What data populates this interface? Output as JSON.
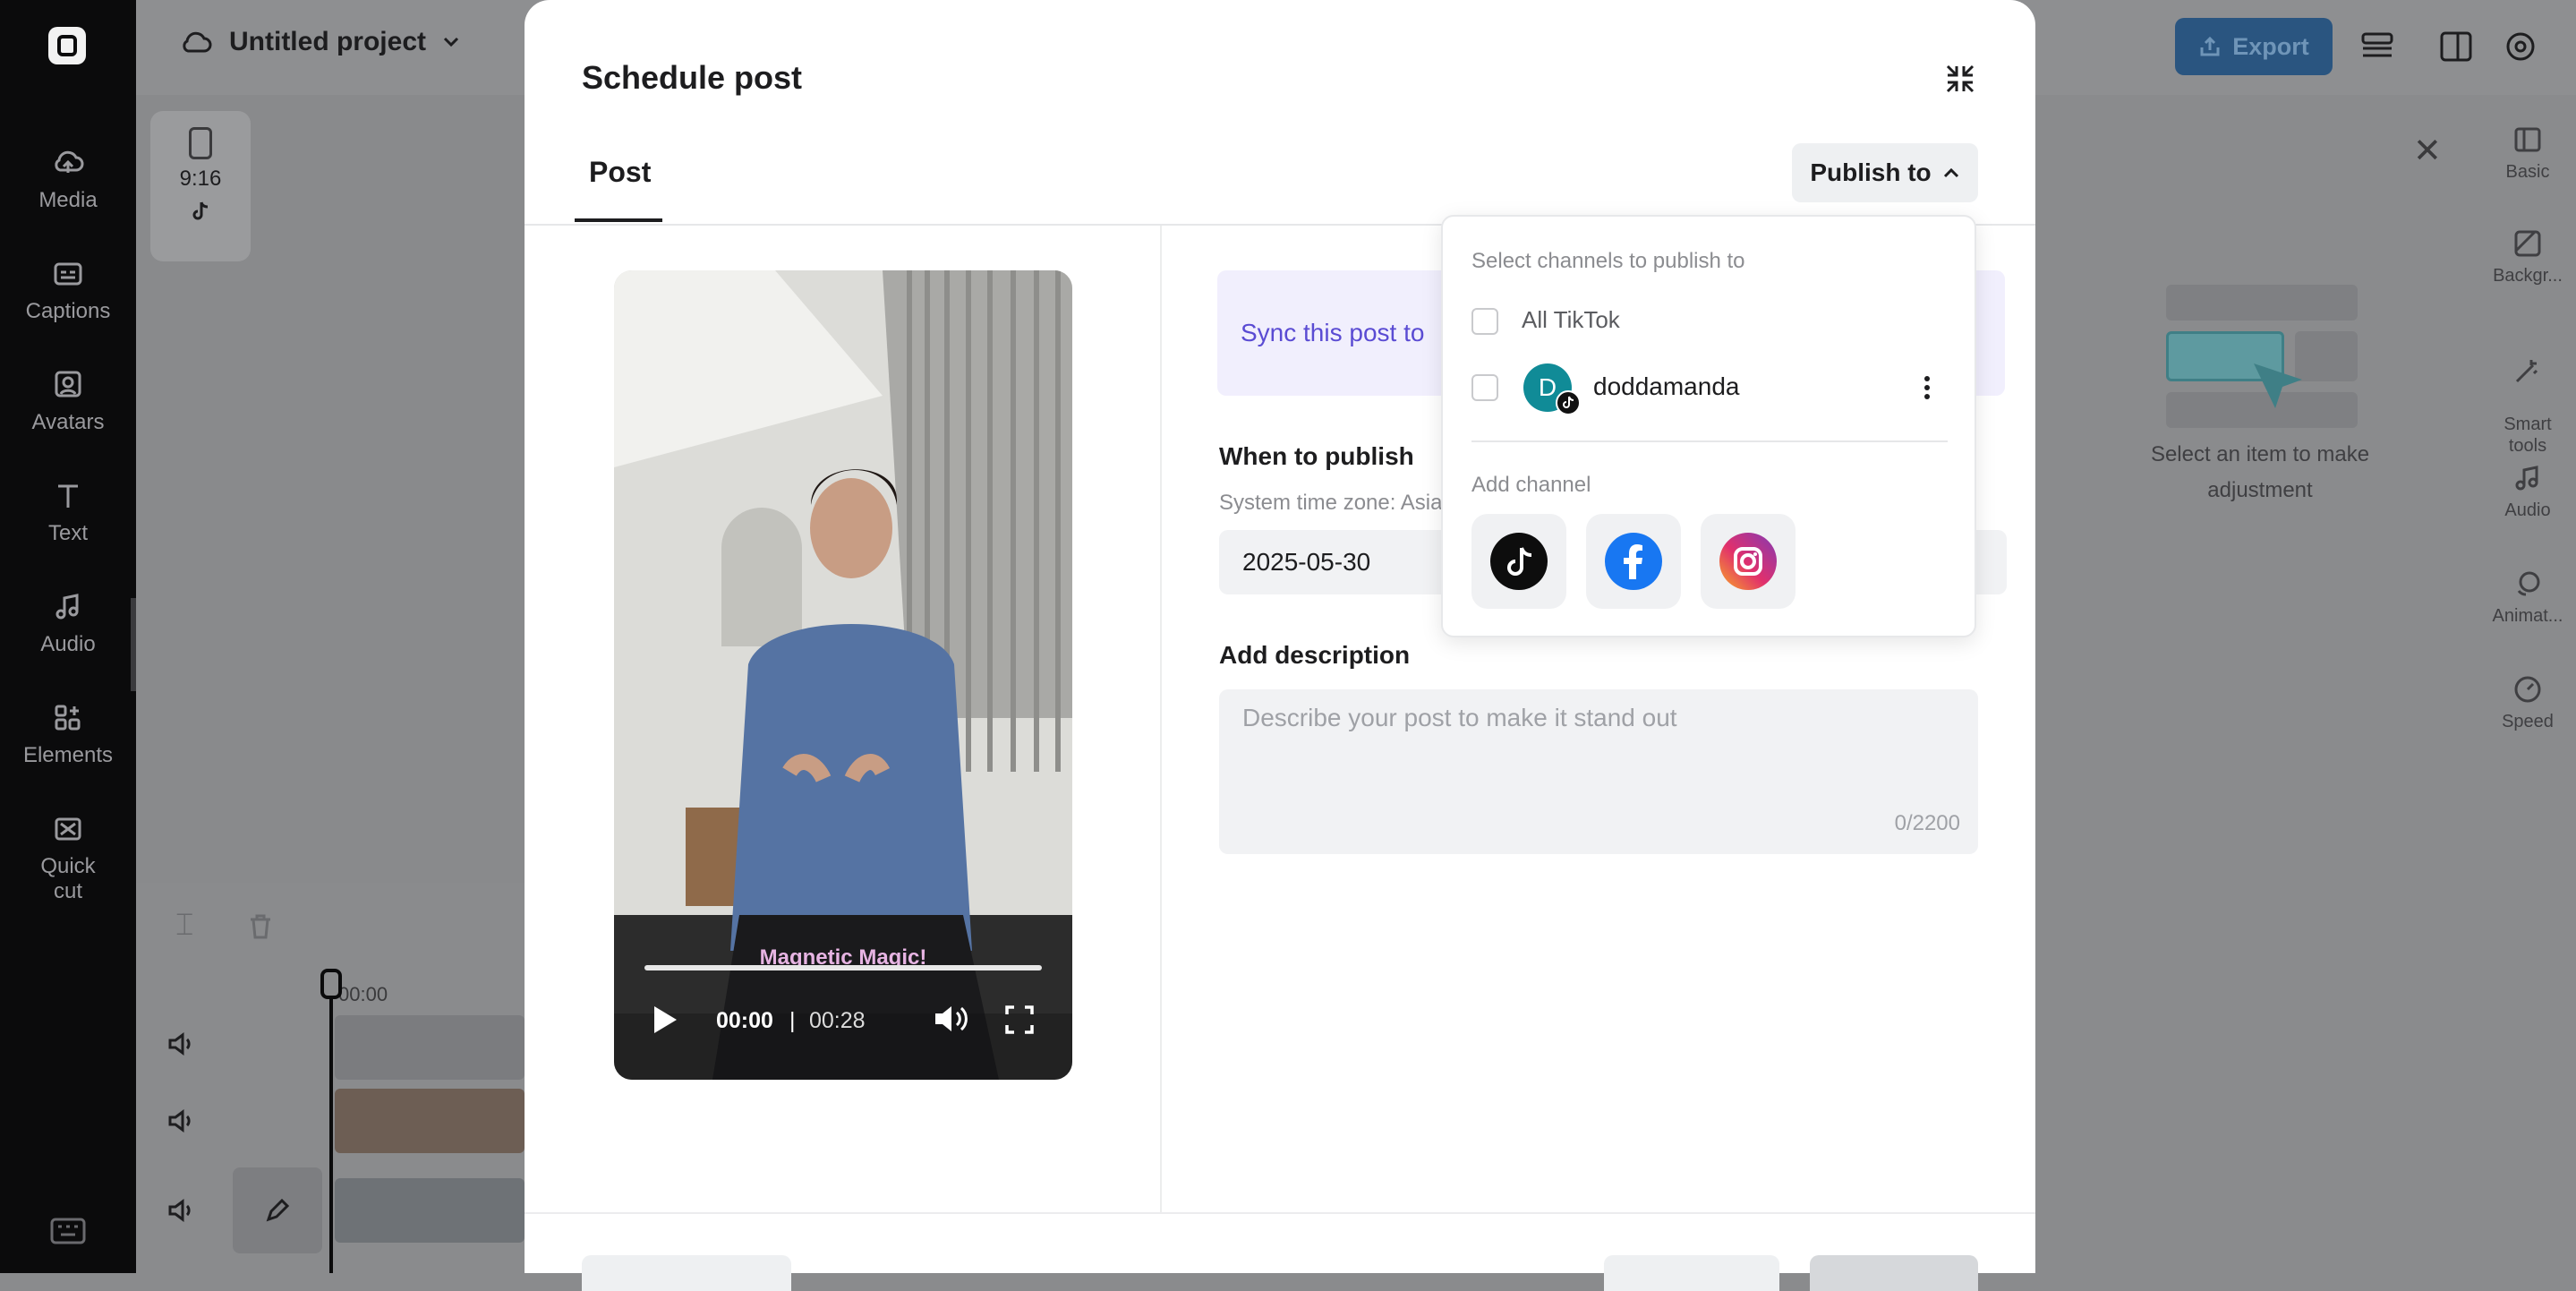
{
  "app": {
    "project_title": "Untitled project",
    "export_label": "Export",
    "rail": [
      {
        "icon": "cloud-upload-icon",
        "label": "Media"
      },
      {
        "icon": "captions-icon",
        "label": "Captions"
      },
      {
        "icon": "avatar-icon",
        "label": "Avatars"
      },
      {
        "icon": "text-icon",
        "label": "Text"
      },
      {
        "icon": "music-note-icon",
        "label": "Audio"
      },
      {
        "icon": "elements-icon",
        "label": "Elements"
      },
      {
        "icon": "quick-cut-icon",
        "label": "Quick\ncut"
      }
    ],
    "aspect_ratio": "9:16",
    "right_rail": [
      {
        "icon": "basic-icon",
        "label": "Basic"
      },
      {
        "icon": "background-icon",
        "label": "Backgr..."
      },
      {
        "icon": "smart-tools-icon",
        "label": "Smart\ntools"
      },
      {
        "icon": "audio-icon",
        "label": "Audio"
      },
      {
        "icon": "animation-icon",
        "label": "Animat..."
      },
      {
        "icon": "speed-icon",
        "label": "Speed"
      }
    ],
    "empty_panel_text": "Select an item to make adjustment",
    "timeline_time": "00:00"
  },
  "modal": {
    "title": "Schedule post",
    "tab_post": "Post",
    "publish_to_label": "Publish to",
    "sync_text": "Sync this post to",
    "when_label": "When to publish",
    "timezone_label": "System time zone: Asia",
    "date_value": "2025-05-30",
    "description_label": "Add description",
    "description_placeholder": "Describe your post to make it stand out",
    "description_count": "0/2200"
  },
  "video": {
    "caption": "Magnetic Magic!",
    "current_time": "00:00",
    "separator": "|",
    "duration": "00:28",
    "progress": 0
  },
  "dropdown": {
    "heading": "Select channels to publish to",
    "all_option": "All TikTok",
    "all_checked": false,
    "account_initial": "D",
    "account_name": "doddamanda",
    "account_checked": false,
    "add_channel_label": "Add channel",
    "channels": [
      "tiktok-icon",
      "facebook-icon",
      "instagram-icon"
    ]
  },
  "colors": {
    "accent_purple": "#5a4bd3",
    "avatar_teal": "#108b97",
    "export_blue": "#2a5580"
  }
}
